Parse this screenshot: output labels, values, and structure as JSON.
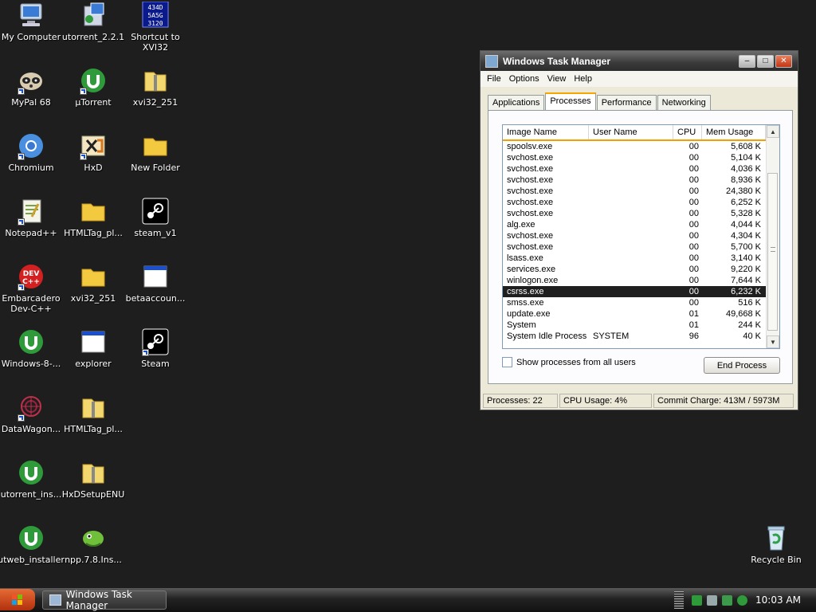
{
  "desktop": {
    "icons": [
      {
        "label": "My Computer"
      },
      {
        "label": "utorrent_2.2.1"
      },
      {
        "label": "Shortcut to\nXVI32"
      },
      {
        "label": "MyPal 68"
      },
      {
        "label": "µTorrent"
      },
      {
        "label": "xvi32_251"
      },
      {
        "label": "Chromium"
      },
      {
        "label": "HxD"
      },
      {
        "label": "New Folder"
      },
      {
        "label": "Notepad++"
      },
      {
        "label": "HTMLTag_pl..."
      },
      {
        "label": "steam_v1"
      },
      {
        "label": "Embarcadero\nDev-C++"
      },
      {
        "label": "xvi32_251"
      },
      {
        "label": "betaaccoun..."
      },
      {
        "label": "Windows-8-..."
      },
      {
        "label": "explorer"
      },
      {
        "label": "Steam"
      },
      {
        "label": "DataWagon..."
      },
      {
        "label": "HTMLTag_pl..."
      },
      {
        "label": "utorrent_ins..."
      },
      {
        "label": "HxDSetupENU"
      },
      {
        "label": "utweb_installer"
      },
      {
        "label": "npp.7.8.Ins..."
      },
      {
        "label": "Recycle Bin"
      }
    ],
    "xvi_icon_text": [
      "434D",
      "5A5G",
      "3120"
    ],
    "devcpp_icon_text": [
      "DEV",
      "C++"
    ]
  },
  "window": {
    "title": "Windows Task Manager",
    "buttons": {
      "minimize": "–",
      "maximize": "□",
      "close": "✕"
    },
    "menu": [
      "File",
      "Options",
      "View",
      "Help"
    ],
    "tabs": [
      "Applications",
      "Processes",
      "Performance",
      "Networking"
    ],
    "active_tab": "Processes",
    "columns": [
      "Image Name",
      "User Name",
      "CPU",
      "Mem Usage"
    ],
    "processes": [
      {
        "name": "spoolsv.exe",
        "user": "",
        "cpu": "00",
        "mem": "5,608 K"
      },
      {
        "name": "svchost.exe",
        "user": "",
        "cpu": "00",
        "mem": "5,104 K"
      },
      {
        "name": "svchost.exe",
        "user": "",
        "cpu": "00",
        "mem": "4,036 K"
      },
      {
        "name": "svchost.exe",
        "user": "",
        "cpu": "00",
        "mem": "8,936 K"
      },
      {
        "name": "svchost.exe",
        "user": "",
        "cpu": "00",
        "mem": "24,380 K"
      },
      {
        "name": "svchost.exe",
        "user": "",
        "cpu": "00",
        "mem": "6,252 K"
      },
      {
        "name": "svchost.exe",
        "user": "",
        "cpu": "00",
        "mem": "5,328 K"
      },
      {
        "name": "alg.exe",
        "user": "",
        "cpu": "00",
        "mem": "4,044 K"
      },
      {
        "name": "svchost.exe",
        "user": "",
        "cpu": "00",
        "mem": "4,304 K"
      },
      {
        "name": "svchost.exe",
        "user": "",
        "cpu": "00",
        "mem": "5,700 K"
      },
      {
        "name": "lsass.exe",
        "user": "",
        "cpu": "00",
        "mem": "3,140 K"
      },
      {
        "name": "services.exe",
        "user": "",
        "cpu": "00",
        "mem": "9,220 K"
      },
      {
        "name": "winlogon.exe",
        "user": "",
        "cpu": "00",
        "mem": "7,644 K"
      },
      {
        "name": "csrss.exe",
        "user": "",
        "cpu": "00",
        "mem": "6,232 K",
        "selected": true
      },
      {
        "name": "smss.exe",
        "user": "",
        "cpu": "00",
        "mem": "516 K"
      },
      {
        "name": "update.exe",
        "user": "",
        "cpu": "01",
        "mem": "49,668 K"
      },
      {
        "name": "System",
        "user": "",
        "cpu": "01",
        "mem": "244 K"
      },
      {
        "name": "System Idle Process",
        "user": "SYSTEM",
        "cpu": "96",
        "mem": "40 K"
      }
    ],
    "show_all_users": "Show processes from all users",
    "end_process": "End Process",
    "status": {
      "processes": "Processes: 22",
      "cpu": "CPU Usage: 4%",
      "commit": "Commit Charge: 413M / 5973M"
    }
  },
  "taskbar": {
    "task_button": "Windows Task Manager",
    "clock": "10:03 AM"
  },
  "colors": {
    "desktop_bg": "#1e1e1e",
    "utorrent_green": "#2e9a3a",
    "folder_yellow": "#f3c940",
    "selection": "#1f1f1f",
    "tab_highlight": "#f7a600"
  }
}
